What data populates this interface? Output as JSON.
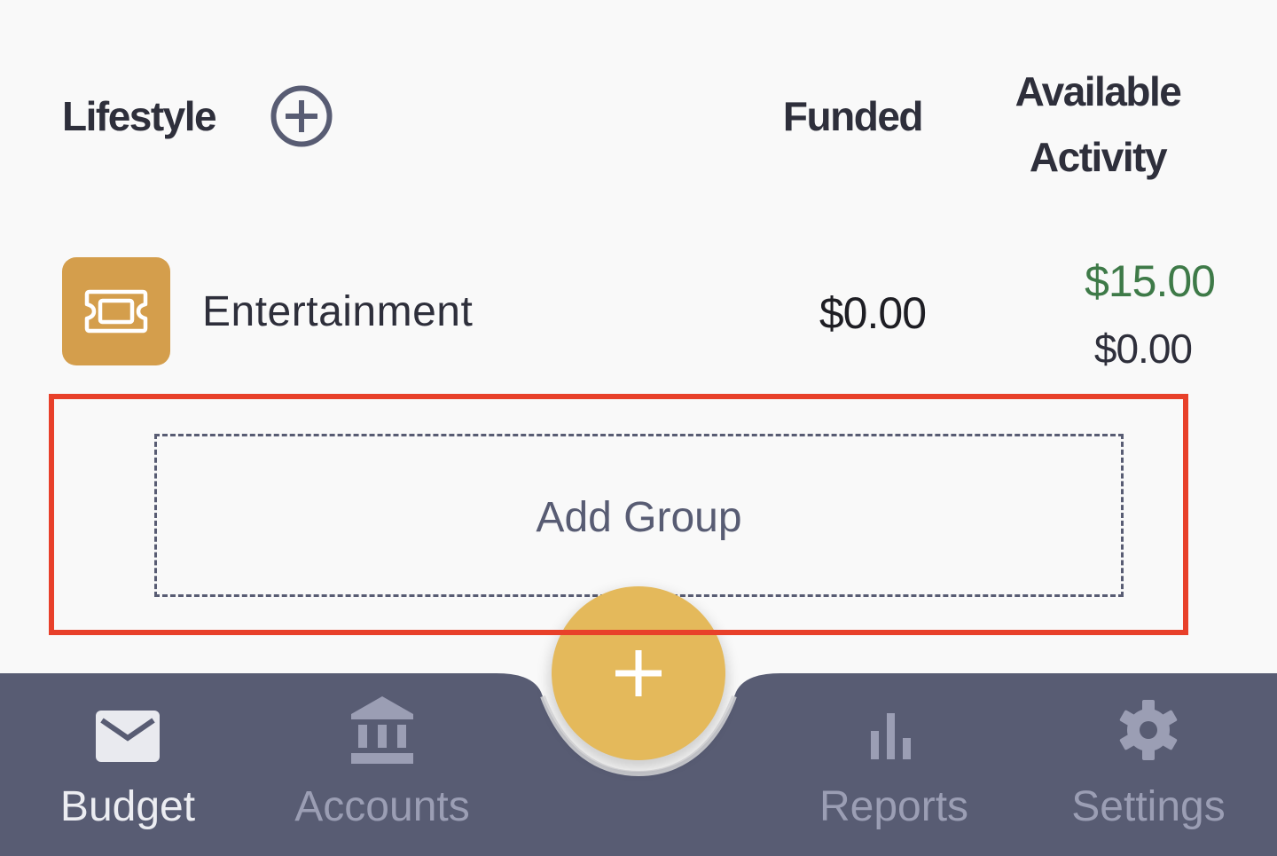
{
  "header": {
    "group_title": "Lifestyle",
    "add_category_icon": "plus-circle-icon",
    "col_funded": "Funded",
    "col_available": "Available",
    "col_activity": "Activity"
  },
  "categories": [
    {
      "name": "Entertainment",
      "icon": "ticket-icon",
      "icon_color": "#d49e4c",
      "funded": "$0.00",
      "available": "$15.00",
      "available_color": "#3e7a48",
      "activity": "$0.00"
    }
  ],
  "add_group": {
    "label": "Add Group"
  },
  "fab": {
    "icon": "plus-icon",
    "color": "#e4b95b"
  },
  "nav": {
    "background": "#585c73",
    "items": [
      {
        "label": "Budget",
        "icon": "envelope-icon",
        "active": true
      },
      {
        "label": "Accounts",
        "icon": "bank-icon",
        "active": false
      },
      {
        "label": "Reports",
        "icon": "bar-chart-icon",
        "active": false
      },
      {
        "label": "Settings",
        "icon": "gear-icon",
        "active": false
      }
    ]
  },
  "colors": {
    "highlight": "#e8402a",
    "text_primary": "#2e2f3b",
    "positive": "#3e7a48"
  }
}
